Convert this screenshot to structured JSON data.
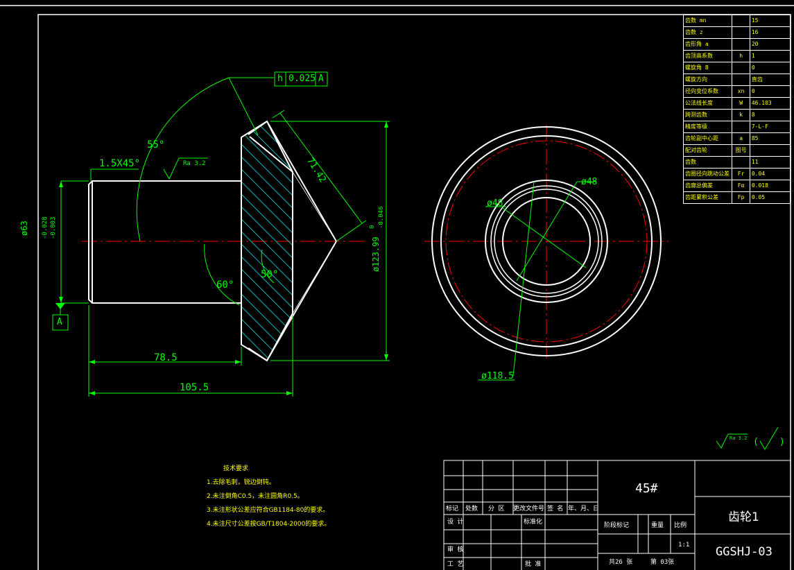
{
  "params": [
    {
      "name": "齿数    mn",
      "sym": "",
      "val": "15"
    },
    {
      "name": "齿数    z",
      "sym": "",
      "val": "16"
    },
    {
      "name": "齿形角  a",
      "sym": "",
      "val": "20"
    },
    {
      "name": "齿顶高系数",
      "sym": "h",
      "val": "1"
    },
    {
      "name": "螺旋角  B",
      "sym": "",
      "val": "0"
    },
    {
      "name": "螺旋方向",
      "sym": "",
      "val": "直齿"
    },
    {
      "name": "径向变位系数",
      "sym": "xn",
      "val": "0"
    },
    {
      "name": "公法线长度",
      "sym": "W",
      "val": "46.103"
    },
    {
      "name": "跨测齿数",
      "sym": "k",
      "val": "8"
    },
    {
      "name": "精度等级",
      "sym": "",
      "val": "7-L-F"
    },
    {
      "name": "齿轮副中心距",
      "sym": "a",
      "val": "85"
    },
    {
      "name": "配对齿轮",
      "sym": "图号",
      "val": ""
    },
    {
      "name": "齿数",
      "sym": "",
      "val": "11"
    },
    {
      "name": "齿圈径向跳动公差",
      "sym": "Fr",
      "val": "0.04"
    },
    {
      "name": "齿廓总偏差",
      "sym": "Fα",
      "val": "0.018"
    },
    {
      "name": "齿距累积公差",
      "sym": "Fp",
      "val": "0.05"
    }
  ],
  "dims": {
    "tol_h": "h",
    "tol_val": "0.025",
    "tol_ref": "A",
    "ang55": "55°",
    "chamfer": "1.5X45°",
    "ra": "Ra 3.2",
    "d63": "ø63",
    "d63_tol_up": "-0.028",
    "d63_tol_lo": "-0.003",
    "datumA": "A",
    "ang60": "60°",
    "ang50": "50°",
    "len71": "71.42",
    "d123": "ø123.99",
    "d123_tol_up": "0",
    "d123_tol_lo": "-0.046",
    "len78": "78.5",
    "len105": "105.5",
    "d48a": "ø48",
    "d48b": "ø48",
    "d118": "ø118.5",
    "rough_corner": "Ra 3.2",
    "rough_paren_l": "(",
    "rough_paren_r": ")"
  },
  "notes": {
    "title": "技术要求",
    "items": [
      "1.去除毛刺，锐边倒钝。",
      "2.未注倒角C0.5，未注圆角R0.5。",
      "3.未注形状公差应符合GB1184-80的要求。",
      "4.未注尺寸公差按GB/T1804-2000的要求。"
    ]
  },
  "titleblock": {
    "material": "45#",
    "part_name": "齿轮1",
    "drawing_no": "GGSHJ-03",
    "row_labels": [
      "标记",
      "处数",
      "分 区",
      "更改文件号",
      "签 名",
      "年、月、日"
    ],
    "design": "设 计",
    "standard": "标准化",
    "review": "审 核",
    "process": "工 艺",
    "approve": "批 准",
    "stage": "阶段标记",
    "weight": "重量",
    "scale": "比例",
    "scale_val": "1:1",
    "sheets": "共26  张",
    "sheet_no": "第  03张"
  },
  "colors": {
    "outline": "#ffffff",
    "dim": "#00ff00",
    "center": "#ff0000",
    "hatch": "#00e5e5",
    "text": "#ffff00"
  }
}
